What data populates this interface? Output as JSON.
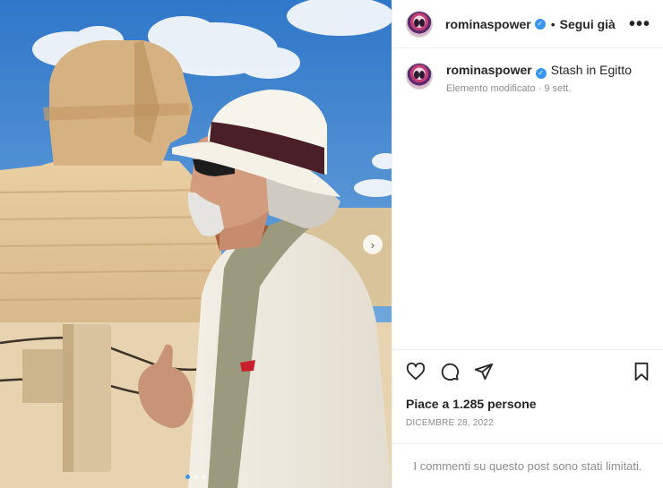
{
  "post": {
    "username": "rominaspower",
    "verified": true,
    "follow_label": "Segui già",
    "more_label": "•••"
  },
  "caption": {
    "username": "rominaspower",
    "text": "Stash in Egitto",
    "meta": "Elemento modificato · 9 sett."
  },
  "actions": {
    "icons": [
      "heart-icon",
      "comment-icon",
      "share-icon",
      "bookmark-icon"
    ],
    "likes": "Piace a 1.285 persone",
    "date": "DICEMBRE 28, 2022"
  },
  "comments": {
    "limited_text": "I commenti su questo post sono stati limitati."
  },
  "media": {
    "next_arrow": "›",
    "carousel_pages": 3,
    "active_page": 1
  },
  "colors": {
    "verified": "#3897f0",
    "sky": "#3d7fc4",
    "muted_text": "#8e8e8e",
    "border": "#efefef"
  }
}
